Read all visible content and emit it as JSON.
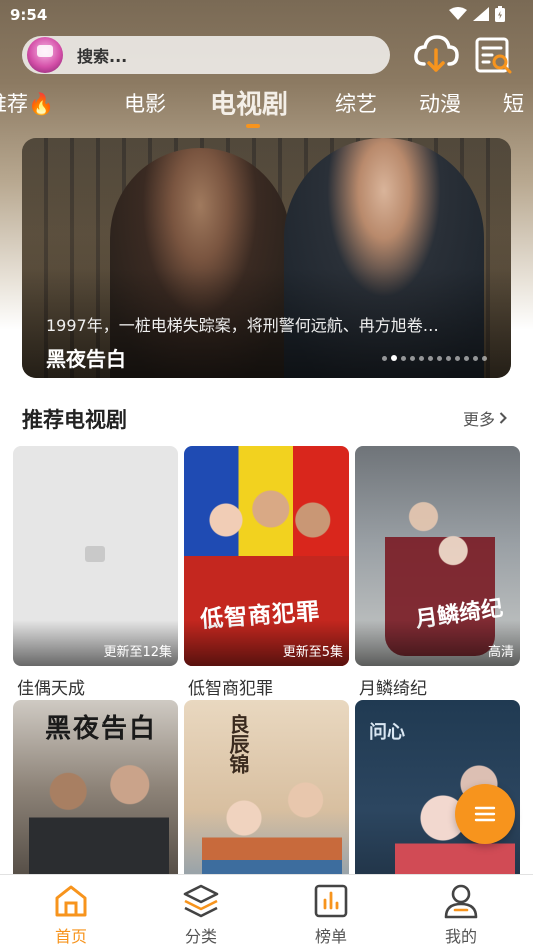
{
  "status_bar": {
    "time": "9:54"
  },
  "search": {
    "placeholder": "搜索..."
  },
  "tabs": [
    {
      "label": "推荐🔥"
    },
    {
      "label": "电影"
    },
    {
      "label": "电视剧",
      "active": true
    },
    {
      "label": "综艺"
    },
    {
      "label": "动漫"
    },
    {
      "label": "短"
    }
  ],
  "banner": {
    "description": "1997年，一桩电梯失踪案，将刑警何远航、冉方旭卷…",
    "title": "黑夜告白",
    "dot_count": 12,
    "active_dot": 1
  },
  "section": {
    "title": "推荐电视剧",
    "more_label": "更多"
  },
  "cards": [
    {
      "title": "佳偶天成",
      "badge": "更新至12集"
    },
    {
      "title": "低智商犯罪",
      "badge": "更新至5集",
      "poster_text": "低智商犯罪"
    },
    {
      "title": "月鳞绮纪",
      "badge": "高清",
      "poster_text": "月鳞绮纪"
    },
    {
      "title": "",
      "badge": "",
      "poster_text": "黑夜告白"
    },
    {
      "title": "",
      "badge": "",
      "poster_text": "良辰锦"
    },
    {
      "title": "",
      "badge": "",
      "poster_text": "问心"
    }
  ],
  "bottom_nav": [
    {
      "label": "首页",
      "icon": "home-icon",
      "active": true
    },
    {
      "label": "分类",
      "icon": "layers-icon"
    },
    {
      "label": "榜单",
      "icon": "chart-icon"
    },
    {
      "label": "我的",
      "icon": "user-icon"
    }
  ],
  "colors": {
    "accent": "#f7941d"
  }
}
